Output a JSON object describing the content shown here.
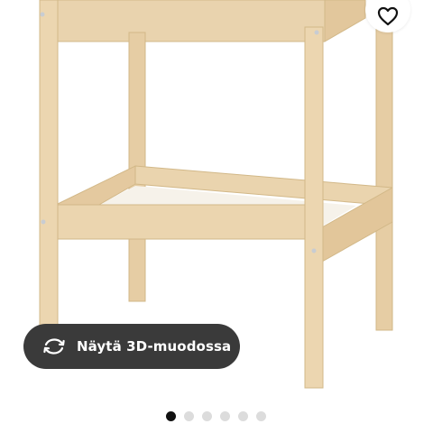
{
  "product": {
    "image_alt": "Wooden changing table with shelf",
    "favorite_icon": "heart-outline-icon"
  },
  "view_3d": {
    "label": "Näytä 3D-muodossa",
    "icon": "rotate-3d-icon"
  },
  "carousel": {
    "total": 6,
    "active_index": 0
  }
}
